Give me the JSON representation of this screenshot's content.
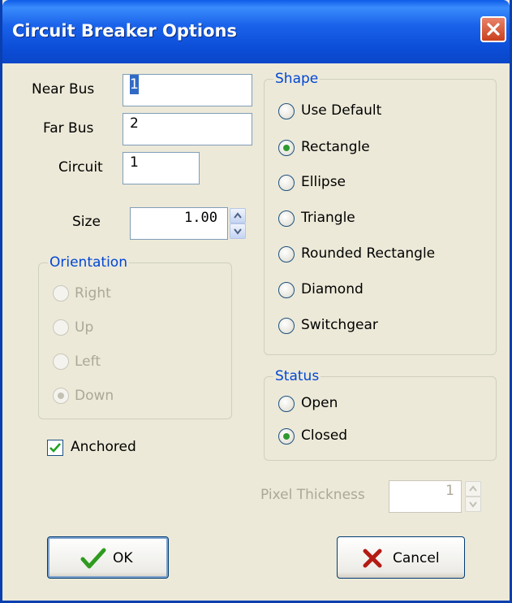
{
  "window": {
    "title": "Circuit Breaker Options"
  },
  "fields": {
    "near_bus": {
      "label": "Near Bus",
      "value": "1"
    },
    "far_bus": {
      "label": "Far Bus",
      "value": "2"
    },
    "circuit": {
      "label": "Circuit",
      "value": "1"
    },
    "size": {
      "label": "Size",
      "value": "1.00"
    }
  },
  "orientation": {
    "title": "Orientation",
    "options": [
      "Right",
      "Up",
      "Left",
      "Down"
    ],
    "selected": "Down",
    "enabled": false
  },
  "anchored": {
    "label": "Anchored",
    "checked": true
  },
  "shape": {
    "title": "Shape",
    "options": [
      "Use Default",
      "Rectangle",
      "Ellipse",
      "Triangle",
      "Rounded Rectangle",
      "Diamond",
      "Switchgear"
    ],
    "selected": "Rectangle"
  },
  "status": {
    "title": "Status",
    "options": [
      "Open",
      "Closed"
    ],
    "selected": "Closed"
  },
  "pixel_thickness": {
    "label": "Pixel Thickness",
    "value": "1",
    "enabled": false
  },
  "buttons": {
    "ok": "OK",
    "cancel": "Cancel"
  },
  "colors": {
    "titlebar": "#0a46c8",
    "group_title": "#0046d5",
    "dialog_bg": "#ece9d8",
    "ok_check": "#2e9b1e",
    "cancel_x": "#b31b14"
  }
}
